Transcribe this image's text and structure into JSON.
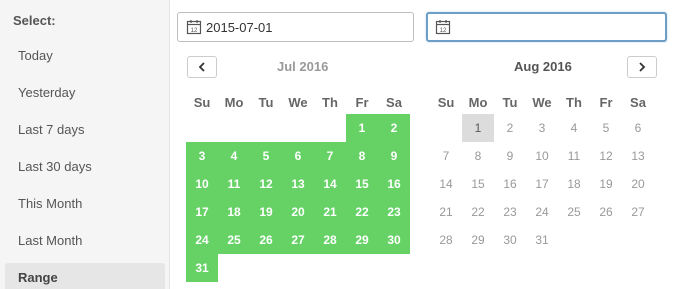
{
  "sidebar": {
    "select_label": "Select:",
    "presets": [
      {
        "label": "Today"
      },
      {
        "label": "Yesterday"
      },
      {
        "label": "Last 7 days"
      },
      {
        "label": "Last 30 days"
      },
      {
        "label": "This Month"
      },
      {
        "label": "Last Month"
      },
      {
        "label": "Range"
      }
    ],
    "active_preset": "Range"
  },
  "start_input": {
    "value": "2015-07-01"
  },
  "end_input": {
    "value": ""
  },
  "weekdays": [
    "Su",
    "Mo",
    "Tu",
    "We",
    "Th",
    "Fr",
    "Sa"
  ],
  "left_month": {
    "title": "Jul 2016",
    "weeks": [
      [
        "",
        "",
        "",
        "",
        "",
        "1",
        "2"
      ],
      [
        "3",
        "4",
        "5",
        "6",
        "7",
        "8",
        "9"
      ],
      [
        "10",
        "11",
        "12",
        "13",
        "14",
        "15",
        "16"
      ],
      [
        "17",
        "18",
        "19",
        "20",
        "21",
        "22",
        "23"
      ],
      [
        "24",
        "25",
        "26",
        "27",
        "28",
        "29",
        "30"
      ],
      [
        "31",
        "",
        "",
        "",
        "",
        "",
        ""
      ]
    ],
    "highlighted_days": "all"
  },
  "right_month": {
    "title": "Aug 2016",
    "weeks": [
      [
        "",
        "1",
        "2",
        "3",
        "4",
        "5",
        "6"
      ],
      [
        "7",
        "8",
        "9",
        "10",
        "11",
        "12",
        "13"
      ],
      [
        "14",
        "15",
        "16",
        "17",
        "18",
        "19",
        "20"
      ],
      [
        "21",
        "22",
        "23",
        "24",
        "25",
        "26",
        "27"
      ],
      [
        "28",
        "29",
        "30",
        "31",
        "",
        "",
        ""
      ]
    ],
    "today": "1"
  },
  "colors": {
    "range_fill": "#66d266",
    "today_fill": "#dcdcdc",
    "focus_border": "#6d9ec6"
  },
  "icons": {
    "input": "calendar-icon",
    "prev": "chevron-left-icon",
    "next": "chevron-right-icon"
  }
}
